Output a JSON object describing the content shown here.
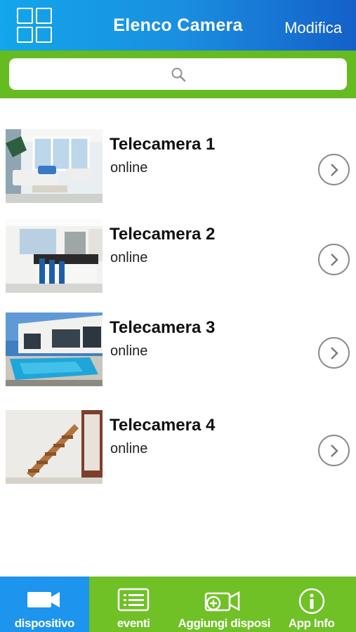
{
  "header": {
    "title": "Elenco Camera",
    "edit_label": "Modifica",
    "menu_icon": "grid-icon",
    "background_start": "#12a6ea",
    "background_end": "#1460c9"
  },
  "search": {
    "placeholder": "",
    "icon": "search-icon",
    "band_color": "#66bb21"
  },
  "cameras": [
    {
      "name": "Telecamera 1",
      "status": "online",
      "thumbnail": "living-room"
    },
    {
      "name": "Telecamera 2",
      "status": "online",
      "thumbnail": "kitchen"
    },
    {
      "name": "Telecamera 3",
      "status": "online",
      "thumbnail": "pool-house"
    },
    {
      "name": "Telecamera 4",
      "status": "online",
      "thumbnail": "staircase"
    }
  ],
  "tabs": [
    {
      "label": "dispositivo",
      "icon": "video-camera-icon",
      "active": true
    },
    {
      "label": "eventi",
      "icon": "list-icon",
      "active": false
    },
    {
      "label": "Aggiungi disposi",
      "icon": "add-camera-icon",
      "active": false
    },
    {
      "label": "App Info",
      "icon": "info-icon",
      "active": false
    }
  ],
  "colors": {
    "tab_bar": "#6fc126",
    "tab_active": "#1d94ee"
  }
}
